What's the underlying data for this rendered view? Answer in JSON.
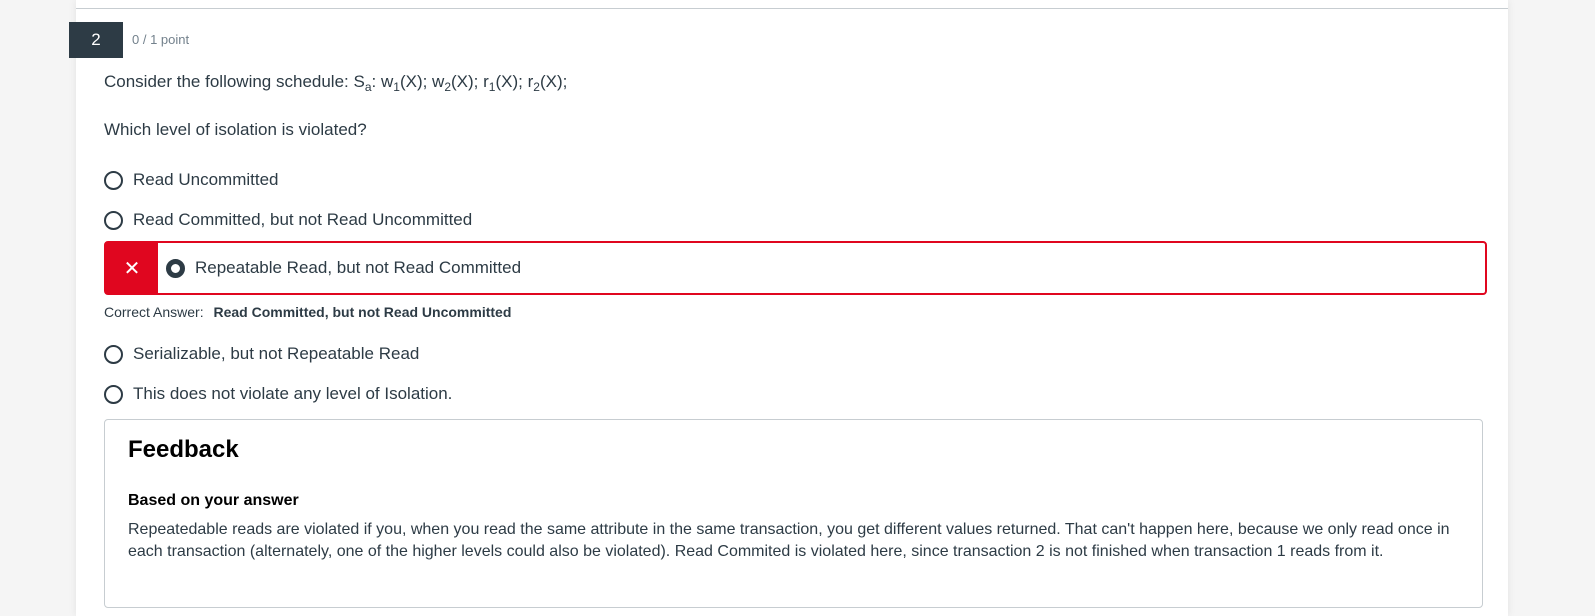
{
  "question": {
    "number": "2",
    "points": "0 / 1 point",
    "schedule_prefix": "Consider the following schedule: S",
    "schedule_sub_a": "a",
    "schedule_seg1": ": w",
    "sub1": "1",
    "schedule_seg2": "(X); w",
    "sub2": "2",
    "schedule_seg3": "(X); r",
    "sub3": "1",
    "schedule_seg4": "(X); r",
    "sub4": "2",
    "schedule_seg5": "(X);",
    "prompt": "Which level of isolation is violated?"
  },
  "answers": [
    {
      "label": "Read Uncommitted",
      "selected": false
    },
    {
      "label": "Read Committed, but not Read Uncommitted",
      "selected": false
    },
    {
      "label": "Repeatable Read, but not Read Committed",
      "selected": true,
      "wrong": true
    },
    {
      "label": "Serializable, but not Repeatable Read",
      "selected": false
    },
    {
      "label": "This does not violate any level of Isolation.",
      "selected": false
    }
  ],
  "wrong_mark": "✕",
  "correct": {
    "label": "Correct Answer:",
    "value": "Read Committed, but not Read Uncommitted"
  },
  "feedback": {
    "title": "Feedback",
    "subtitle": "Based on your answer",
    "text": "Repeatedable reads are violated if you, when you read the same attribute in the same transaction, you get different values returned. That can't happen here, because we only read once in each transaction (alternately, one of the higher levels could also be violated). Read Commited is violated here, since transaction 2 is not finished when transaction 1 reads from it."
  },
  "colors": {
    "dark": "#2d3b45",
    "error_red": "#e0061f",
    "muted": "#73818c"
  }
}
